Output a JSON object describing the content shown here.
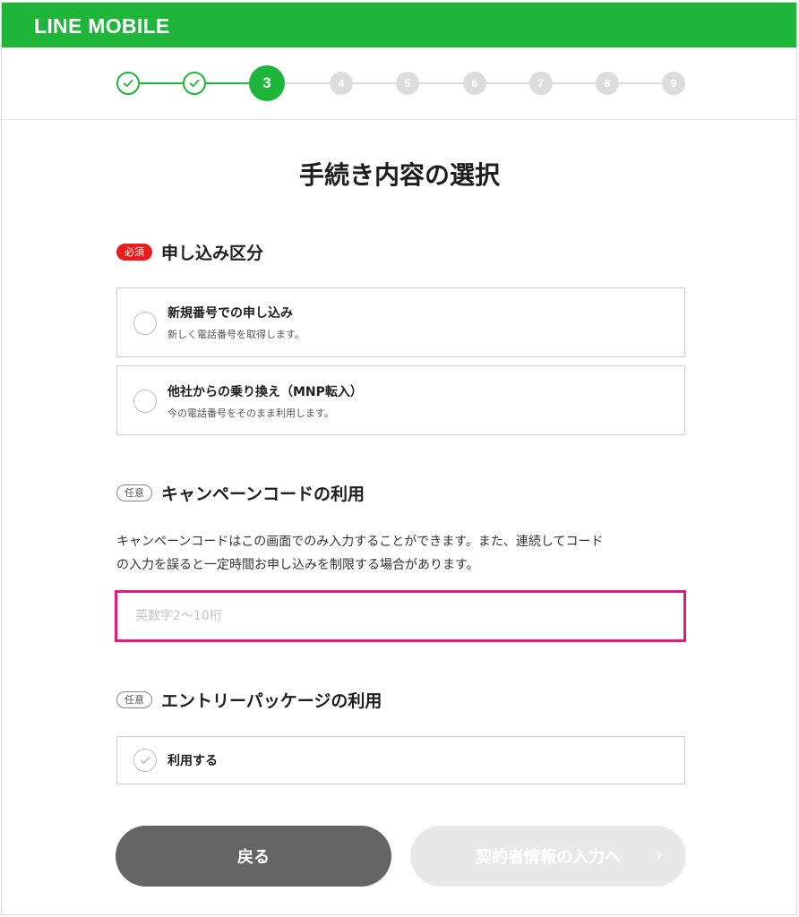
{
  "header": {
    "logo_text": "LINE MOBILE",
    "brand_color": "#1eb53a"
  },
  "stepper": {
    "steps": [
      "",
      "",
      "3",
      "4",
      "5",
      "6",
      "7",
      "8",
      "9"
    ],
    "current_step": 3,
    "total_steps": 9
  },
  "page_title": "手続き内容の選択",
  "application_type": {
    "badge": "必須",
    "heading": "申し込み区分",
    "options": [
      {
        "title": "新規番号での申し込み",
        "desc": "新しく電話番号を取得します。"
      },
      {
        "title": "他社からの乗り換え（MNP転入）",
        "desc": "今の電話番号をそのまま利用します。"
      }
    ]
  },
  "campaign": {
    "badge": "任意",
    "heading": "キャンペーンコードの利用",
    "description_line1": "キャンペーンコードはこの画面でのみ入力することができます。また、連続してコード",
    "description_line2": "の入力を誤ると一定時間お申し込みを制限する場合があります。",
    "input_placeholder": "英数字2〜10桁",
    "input_value": ""
  },
  "entry_package": {
    "badge": "任意",
    "heading": "エントリーパッケージの利用",
    "checkbox_label": "利用する"
  },
  "buttons": {
    "back_label": "戻る",
    "next_label": "契約者情報の入力へ",
    "next_chevron": "›"
  }
}
